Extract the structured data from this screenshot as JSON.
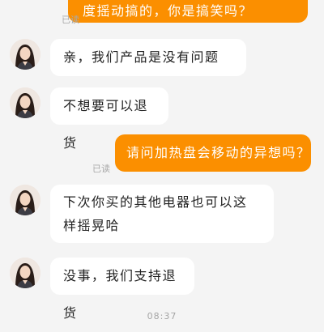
{
  "colors": {
    "background": "#f4f4f4",
    "outgoing_bubble": "#fb8f00",
    "incoming_bubble": "#ffffff"
  },
  "messages": [
    {
      "sender": "me",
      "text": "度摇动搞的，你是搞笑吗？",
      "status": "已读"
    },
    {
      "sender": "agent",
      "text": "亲，我们产品是没有问题哈，",
      "avatar": "avatar-woman-icon"
    },
    {
      "sender": "agent",
      "text": "不想要可以退货",
      "avatar": "avatar-woman-icon"
    },
    {
      "sender": "me",
      "text": "请问加热盘会移动的异想吗？",
      "status": "已读"
    },
    {
      "sender": "agent",
      "text": "下次你买的其他电器也可以这样摇晃哈",
      "avatar": "avatar-woman-icon"
    },
    {
      "sender": "agent",
      "text": "没事，我们支持退货",
      "avatar": "avatar-woman-icon"
    }
  ],
  "timestamp": "08:37"
}
